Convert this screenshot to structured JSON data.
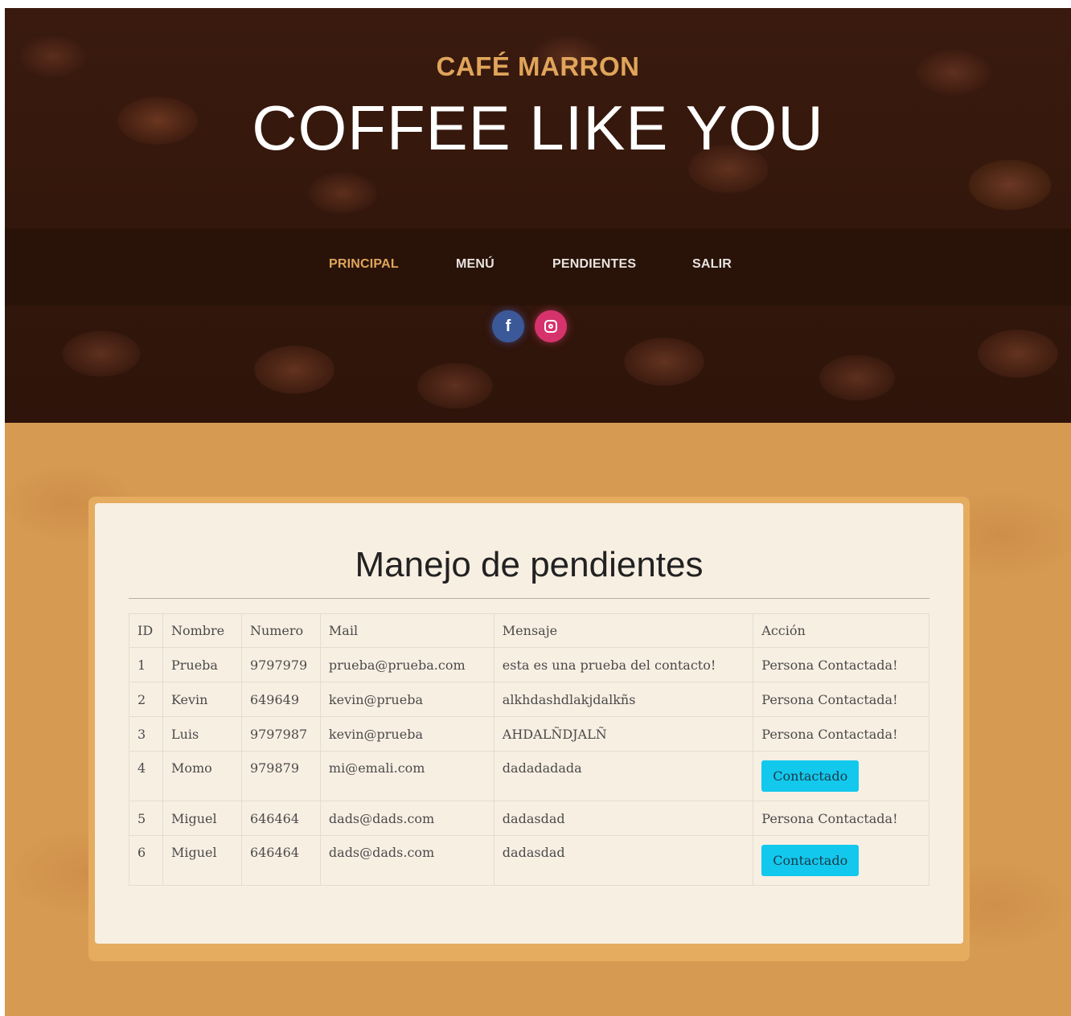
{
  "header": {
    "brand_sub": "CAFÉ MARRON",
    "brand_main": "COFFEE LIKE YOU"
  },
  "nav": {
    "items": [
      {
        "label": "PRINCIPAL",
        "active": true
      },
      {
        "label": "MENÚ",
        "active": false
      },
      {
        "label": "PENDIENTES",
        "active": false
      },
      {
        "label": "SALIR",
        "active": false
      }
    ]
  },
  "social": {
    "facebook_icon": "facebook-icon",
    "facebook_glyph": "f",
    "instagram_icon": "instagram-icon"
  },
  "colors": {
    "accent": "#e0a55b",
    "body_bg": "#d69a52",
    "card_bg": "#f8efe3",
    "button": "#13c8ed"
  },
  "main": {
    "title": "Manejo de pendientes",
    "table": {
      "headers": [
        "ID",
        "Nombre",
        "Numero",
        "Mail",
        "Mensaje",
        "Acción"
      ],
      "rows": [
        {
          "id": "1",
          "nombre": "Prueba",
          "numero": "9797979",
          "mail": "prueba@prueba.com",
          "mensaje": "esta es una prueba del contacto!",
          "accion": "Persona Contactada!"
        },
        {
          "id": "2",
          "nombre": "Kevin",
          "numero": "649649",
          "mail": "kevin@prueba",
          "mensaje": "alkhdashdlakjdalkñs",
          "accion": "Persona Contactada!"
        },
        {
          "id": "3",
          "nombre": "Luis",
          "numero": "9797987",
          "mail": "kevin@prueba",
          "mensaje": "AHDALÑDJALÑ",
          "accion": "Persona Contactada!"
        },
        {
          "id": "4",
          "nombre": "Momo",
          "numero": "979879",
          "mail": "mi@emali.com",
          "mensaje": "dadadadada",
          "accion": "Contactado"
        },
        {
          "id": "5",
          "nombre": "Miguel",
          "numero": "646464",
          "mail": "dads@dads.com",
          "mensaje": "dadasdad",
          "accion": "Persona Contactada!"
        },
        {
          "id": "6",
          "nombre": "Miguel",
          "numero": "646464",
          "mail": "dads@dads.com",
          "mensaje": "dadasdad",
          "accion": "Contactado"
        }
      ]
    }
  }
}
